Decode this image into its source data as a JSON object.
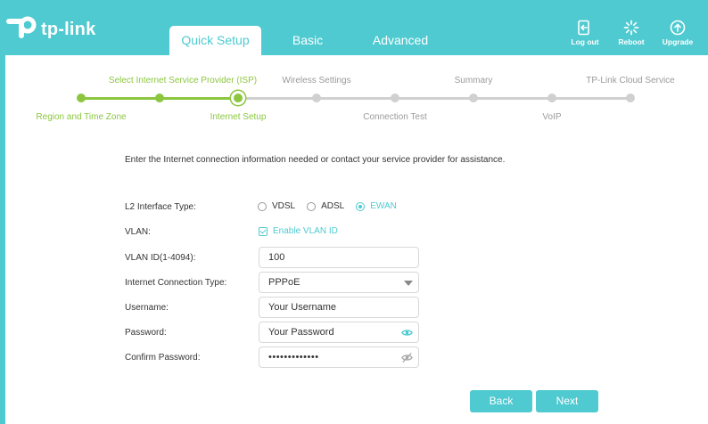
{
  "brand": {
    "name": "tp-link"
  },
  "tabs": [
    {
      "label": "Quick Setup",
      "active": true
    },
    {
      "label": "Basic",
      "active": false
    },
    {
      "label": "Advanced",
      "active": false
    }
  ],
  "header_actions": [
    {
      "label": "Log out",
      "icon": "logout-icon"
    },
    {
      "label": "Reboot",
      "icon": "reboot-icon"
    },
    {
      "label": "Upgrade",
      "icon": "upgrade-icon"
    }
  ],
  "stepper": {
    "top_labels": [
      "Select Internet Service Provider (ISP)",
      "Wireless Settings",
      "Summary",
      "TP-Link Cloud Service"
    ],
    "bottom_labels": [
      "Region and Time Zone",
      "Internet Setup",
      "Connection Test",
      "VoIP"
    ],
    "completed_steps": 2,
    "current_step": 3,
    "total_steps": 8
  },
  "form": {
    "intro": "Enter the Internet connection information needed or contact your service provider for assistance.",
    "l2_label": "L2 Interface Type:",
    "l2_options": [
      "VDSL",
      "ADSL",
      "EWAN"
    ],
    "l2_selected": "EWAN",
    "vlan_label": "VLAN:",
    "vlan_checkbox": "Enable VLAN ID",
    "vlan_id_label": "VLAN ID(1-4094):",
    "vlan_id_value": "100",
    "conn_type_label": "Internet Connection Type:",
    "conn_type_value": "PPPoE",
    "username_label": "Username:",
    "username_placeholder": "Your Username",
    "password_label": "Password:",
    "password_placeholder": "Your Password",
    "confirm_label": "Confirm Password:",
    "confirm_value": "•••••••••••••"
  },
  "buttons": {
    "back": "Back",
    "next": "Next"
  },
  "colors": {
    "accent": "#4ecad0",
    "step_done": "#8cc63f",
    "step_todo": "#d0d0d0"
  }
}
